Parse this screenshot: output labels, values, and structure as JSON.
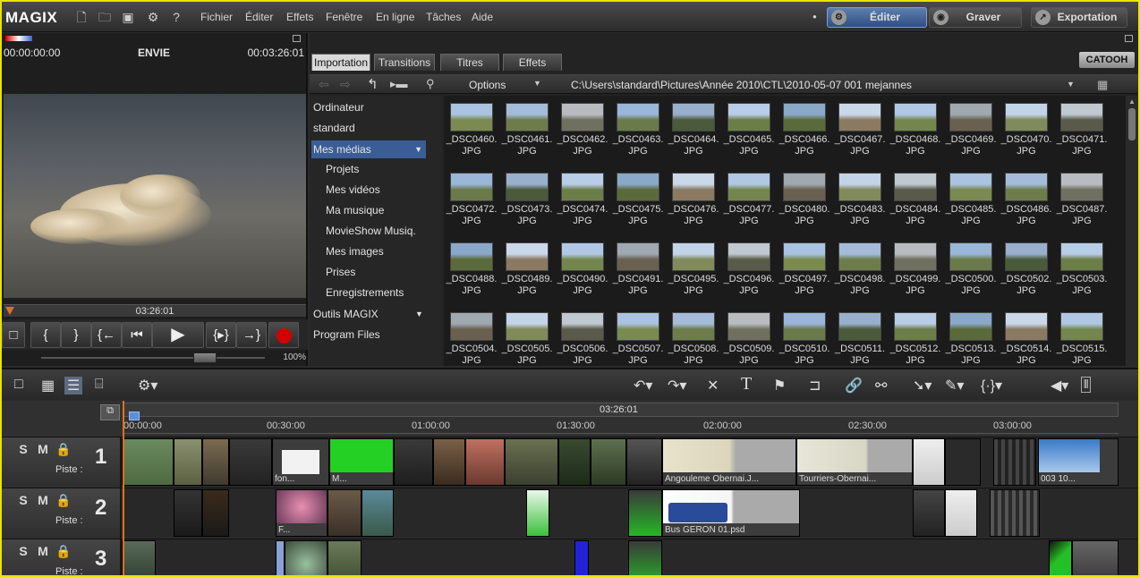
{
  "app": {
    "logo": "MAGIX"
  },
  "menu": {
    "items": [
      "Fichier",
      "Éditer",
      "Effets",
      "Fenêtre",
      "En ligne",
      "Tâches",
      "Aide"
    ]
  },
  "modes": {
    "edit": "Éditer",
    "burn": "Graver",
    "export": "Exportation"
  },
  "preview": {
    "time_left": "00:00:00:00",
    "title": "ENVIE",
    "time_right": "00:03:26:01",
    "ruler_time": "03:26:01",
    "zoom": "100%",
    "transport": [
      "{",
      "}",
      "{←",
      "⏮",
      "▶",
      "{▸}",
      "→}"
    ]
  },
  "pool": {
    "tabs": [
      "Importation",
      "Transitions",
      "Titres",
      "Effets"
    ],
    "brand": "CATOOH",
    "options_label": "Options",
    "path": "C:\\Users\\standard\\Pictures\\Année 2010\\CTL\\2010-05-07 001 mejannes",
    "nav": [
      "Ordinateur",
      "standard",
      "Mes médias",
      "Projets",
      "Mes vidéos",
      "Ma musique",
      "MovieShow Musiq.",
      "Mes images",
      "Prises",
      "Enregistrements",
      "Outils MAGIX",
      "Program Files"
    ],
    "ext": "JPG",
    "files": [
      "_DSC0460.",
      "_DSC0461.",
      "_DSC0462.",
      "_DSC0463.",
      "_DSC0464.",
      "_DSC0465.",
      "_DSC0466.",
      "_DSC0467.",
      "_DSC0468.",
      "_DSC0469.",
      "_DSC0470.",
      "_DSC0471.",
      "_DSC0472.",
      "_DSC0473.",
      "_DSC0474.",
      "_DSC0475.",
      "_DSC0476.",
      "_DSC0477.",
      "_DSC0480.",
      "_DSC0483.",
      "_DSC0484.",
      "_DSC0485.",
      "_DSC0486.",
      "_DSC0487.",
      "_DSC0488.",
      "_DSC0489.",
      "_DSC0490.",
      "_DSC0491.",
      "_DSC0495.",
      "_DSC0496.",
      "_DSC0497.",
      "_DSC0498.",
      "_DSC0499.",
      "_DSC0500.",
      "_DSC0502.",
      "_DSC0503.",
      "_DSC0504.",
      "_DSC0505.",
      "_DSC0506.",
      "_DSC0507.",
      "_DSC0508.",
      "_DSC0509.",
      "_DSC0510.",
      "_DSC0511.",
      "_DSC0512.",
      "_DSC0513.",
      "_DSC0514.",
      "_DSC0515."
    ]
  },
  "timeline": {
    "center_time": "03:26:01",
    "ticks": [
      "00:00:00",
      "00:30:00",
      "01:00:00",
      "01:30:00",
      "02:00:00",
      "02:30:00",
      "03:00:00"
    ],
    "track_label": "Piste :",
    "tracks": [
      {
        "num": "1",
        "clips": [
          "fon...",
          "M...",
          "Angouleme Obernai.J...",
          "Tourriers-Obernai...",
          "003 10..."
        ]
      },
      {
        "num": "2",
        "clips": [
          "F...",
          "Bus GERON 01.psd"
        ]
      },
      {
        "num": "3",
        "clips": []
      }
    ]
  }
}
